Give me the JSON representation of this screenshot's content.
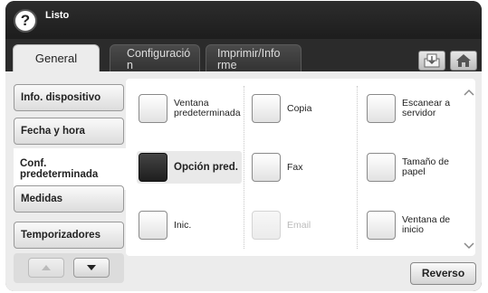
{
  "status": {
    "text": "Listo"
  },
  "tabs": [
    {
      "label": "General",
      "active": true
    },
    {
      "label": "Configuració\nn",
      "active": false
    },
    {
      "label": "Imprimir/Info\nrme",
      "active": false
    }
  ],
  "toolbar": {
    "job_icon": "job-status-icon",
    "home_icon": "home-icon"
  },
  "sidebar": {
    "items": [
      {
        "label": "Info. dispositivo",
        "selected": false
      },
      {
        "label": "Fecha y hora",
        "selected": false
      },
      {
        "label": "Conf.\npredeterminada",
        "selected": true
      },
      {
        "label": "Medidas",
        "selected": false
      },
      {
        "label": "Temporizadores",
        "selected": false
      }
    ],
    "up_icon": "triangle-up-icon",
    "down_icon": "triangle-down-icon"
  },
  "options": [
    {
      "label": "Ventana\npredeterminada",
      "state": "normal"
    },
    {
      "label": "Copia",
      "state": "normal"
    },
    {
      "label": "Escanear a\nservidor",
      "state": "normal"
    },
    {
      "label": "Opción pred.",
      "state": "selected"
    },
    {
      "label": "Fax",
      "state": "normal"
    },
    {
      "label": "Tamaño de\npapel",
      "state": "normal"
    },
    {
      "label": "Inic.",
      "state": "normal"
    },
    {
      "label": "Email",
      "state": "disabled"
    },
    {
      "label": "Ventana de\ninicio",
      "state": "normal"
    }
  ],
  "scroll": {
    "up_icon": "chevron-up-icon",
    "down_icon": "chevron-down-icon"
  },
  "reverse_button": {
    "label": "Reverso"
  },
  "colors": {
    "topbar": "#1f1f1f",
    "panel": "#ececec",
    "selected_box": "#2b2b2b"
  }
}
